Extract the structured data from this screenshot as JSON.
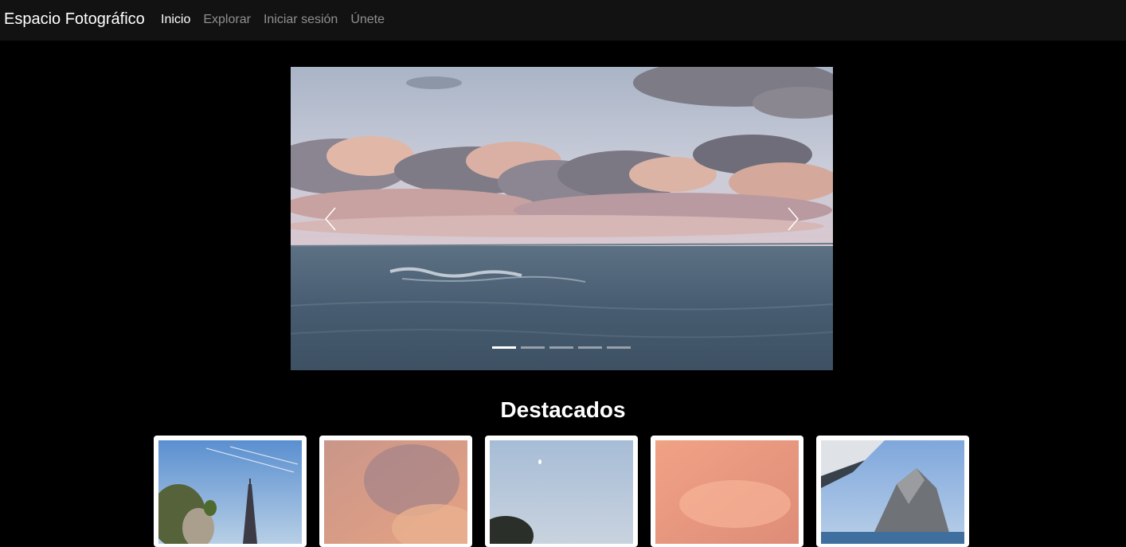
{
  "navbar": {
    "brand": "Espacio Fotográfico",
    "links": [
      {
        "label": "Inicio",
        "active": true
      },
      {
        "label": "Explorar",
        "active": false
      },
      {
        "label": "Iniciar sesión",
        "active": false
      },
      {
        "label": "Únete",
        "active": false
      }
    ]
  },
  "carousel": {
    "slide_count": 5,
    "active_slide": 1,
    "prev_icon": "chevron-left-icon",
    "next_icon": "chevron-right-icon"
  },
  "featured": {
    "title": "Destacados"
  },
  "colors": {
    "navbar_bg": "#121212",
    "page_bg": "#000000",
    "nav_active": "#ffffff",
    "nav_inactive": "#8f8f8f"
  }
}
